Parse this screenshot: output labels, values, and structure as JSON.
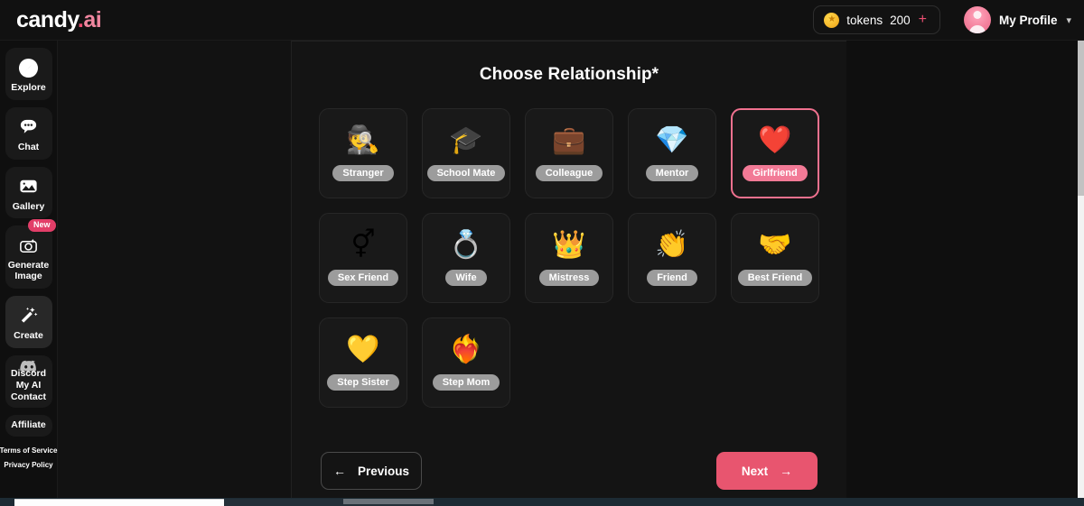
{
  "brand": {
    "name_white": "candy",
    "name_pink": ".",
    "name_pink2": "ai"
  },
  "topbar": {
    "tokens_icon": "coin-star-icon",
    "tokens_label": "tokens",
    "tokens_value": "200",
    "tokens_add": "+",
    "profile_name": "My Profile",
    "profile_chevron": "⌄"
  },
  "sidebar": {
    "items": [
      {
        "label": "Explore",
        "icon": "compass-icon",
        "active": false
      },
      {
        "label": "Chat",
        "icon": "chat-bubble-icon",
        "active": false
      },
      {
        "label": "Gallery",
        "icon": "gallery-image-icon",
        "active": false
      },
      {
        "label": "Generate\nImage",
        "icon": "magic-camera-icon",
        "active": false,
        "badge": "New"
      },
      {
        "label": "Create",
        "icon": "magic-wand-icon",
        "active": true
      }
    ],
    "group": {
      "icon": "discord-icon",
      "discord": "Discord",
      "my_ai": "My AI",
      "contact": "Contact"
    },
    "affiliate": "Affiliate",
    "legal": [
      "Terms of Service",
      "Privacy Policy"
    ]
  },
  "main": {
    "title": "Choose Relationship*",
    "cards": [
      {
        "label": "Stranger",
        "emoji": "🕵️",
        "icon": "detective-hat-icon",
        "selected": false
      },
      {
        "label": "School Mate",
        "emoji": "🎓",
        "icon": "graduation-cap-icon",
        "selected": false
      },
      {
        "label": "Colleague",
        "emoji": "💼",
        "icon": "briefcase-icon",
        "selected": false
      },
      {
        "label": "Mentor",
        "emoji": "💎",
        "icon": "diamond-books-icon",
        "selected": false
      },
      {
        "label": "Girlfriend",
        "emoji": "❤️",
        "icon": "red-heart-icon",
        "selected": true
      },
      {
        "label": "Sex Friend",
        "emoji": "⚥",
        "icon": "gender-symbols-icon",
        "selected": false
      },
      {
        "label": "Wife",
        "emoji": "💍",
        "icon": "wedding-rings-icon",
        "selected": false
      },
      {
        "label": "Mistress",
        "emoji": "👑",
        "icon": "crown-icon",
        "selected": false
      },
      {
        "label": "Friend",
        "emoji": "👏",
        "icon": "clapping-hands-icon",
        "selected": false
      },
      {
        "label": "Best Friend",
        "emoji": "🤝",
        "icon": "handshake-icon",
        "selected": false
      },
      {
        "label": "Step Sister",
        "emoji": "💛",
        "icon": "gold-heart-locket-icon",
        "selected": false
      },
      {
        "label": "Step Mom",
        "emoji": "❤️‍🔥",
        "icon": "heart-on-fire-icon",
        "selected": false
      }
    ],
    "prev_label": "Previous",
    "prev_arrow": "←",
    "next_label": "Next",
    "next_arrow": "→"
  },
  "colors": {
    "accent_pink": "#e8556f",
    "selected_border": "#f0718f",
    "badge_pink": "#e23e68",
    "label_gray": "#9c9c9c",
    "bg": "#0f0f0f",
    "panel": "#141414",
    "card": "#191919"
  }
}
